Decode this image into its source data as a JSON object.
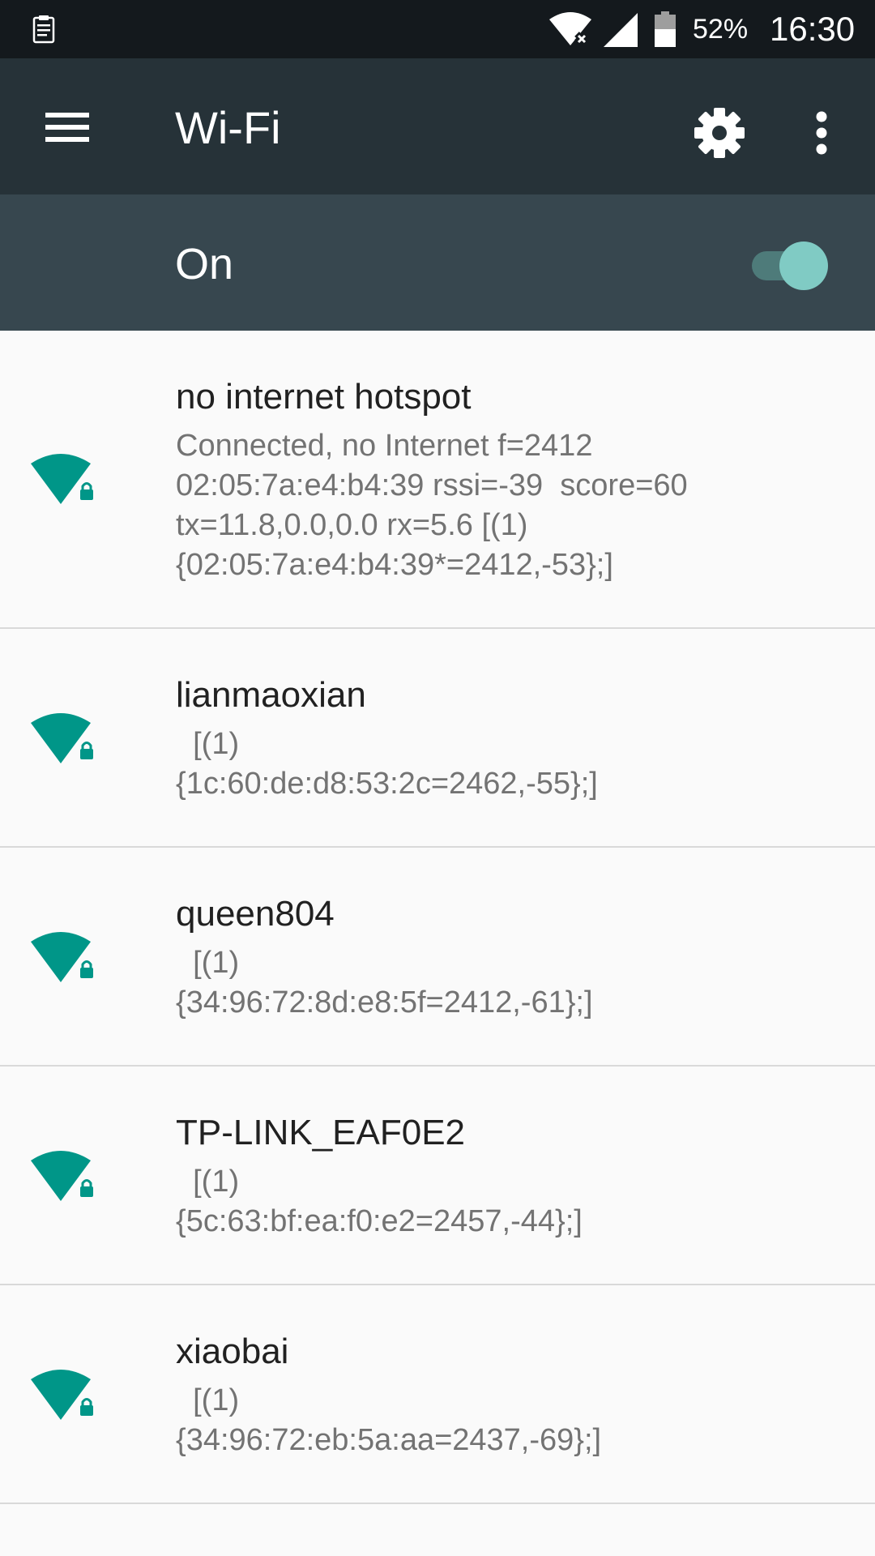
{
  "status_bar": {
    "left_icon": "log-clipboard-icon",
    "wifi_icon": "wifi-no-internet-icon",
    "signal_icon": "cell-signal-icon",
    "battery_icon": "battery-icon",
    "battery_percent": "52%",
    "time": "16:30"
  },
  "toolbar": {
    "menu_icon": "hamburger-menu-icon",
    "title": "Wi-Fi",
    "settings_icon": "gear-icon",
    "more_icon": "more-vert-icon"
  },
  "switch_bar": {
    "label": "On",
    "toggle_on": true
  },
  "colors": {
    "accent": "#009688",
    "toolbar_bg": "#263238",
    "switch_bar_bg": "#37474f",
    "status_bar_bg": "#14191d"
  },
  "networks": [
    {
      "ssid": "no internet hotspot",
      "icon": "wifi-lock-icon",
      "summary_lines": [
        "Connected, no Internet f=2412",
        "02:05:7a:e4:b4:39 rssi=-39  score=60",
        "tx=11.8,0.0,0.0 rx=5.6 [(1)",
        "{02:05:7a:e4:b4:39*=2412,-53};]"
      ]
    },
    {
      "ssid": "lianmaoxian",
      "icon": "wifi-lock-icon",
      "summary_lines": [
        "  [(1)",
        "{1c:60:de:d8:53:2c=2462,-55};]"
      ]
    },
    {
      "ssid": "queen804",
      "icon": "wifi-lock-icon",
      "summary_lines": [
        "  [(1)",
        "{34:96:72:8d:e8:5f=2412,-61};]"
      ]
    },
    {
      "ssid": "TP-LINK_EAF0E2",
      "icon": "wifi-lock-icon",
      "summary_lines": [
        "  [(1)",
        "{5c:63:bf:ea:f0:e2=2457,-44};]"
      ]
    },
    {
      "ssid": "xiaobai",
      "icon": "wifi-lock-icon",
      "summary_lines": [
        "  [(1)",
        "{34:96:72:eb:5a:aa=2437,-69};]"
      ]
    }
  ]
}
